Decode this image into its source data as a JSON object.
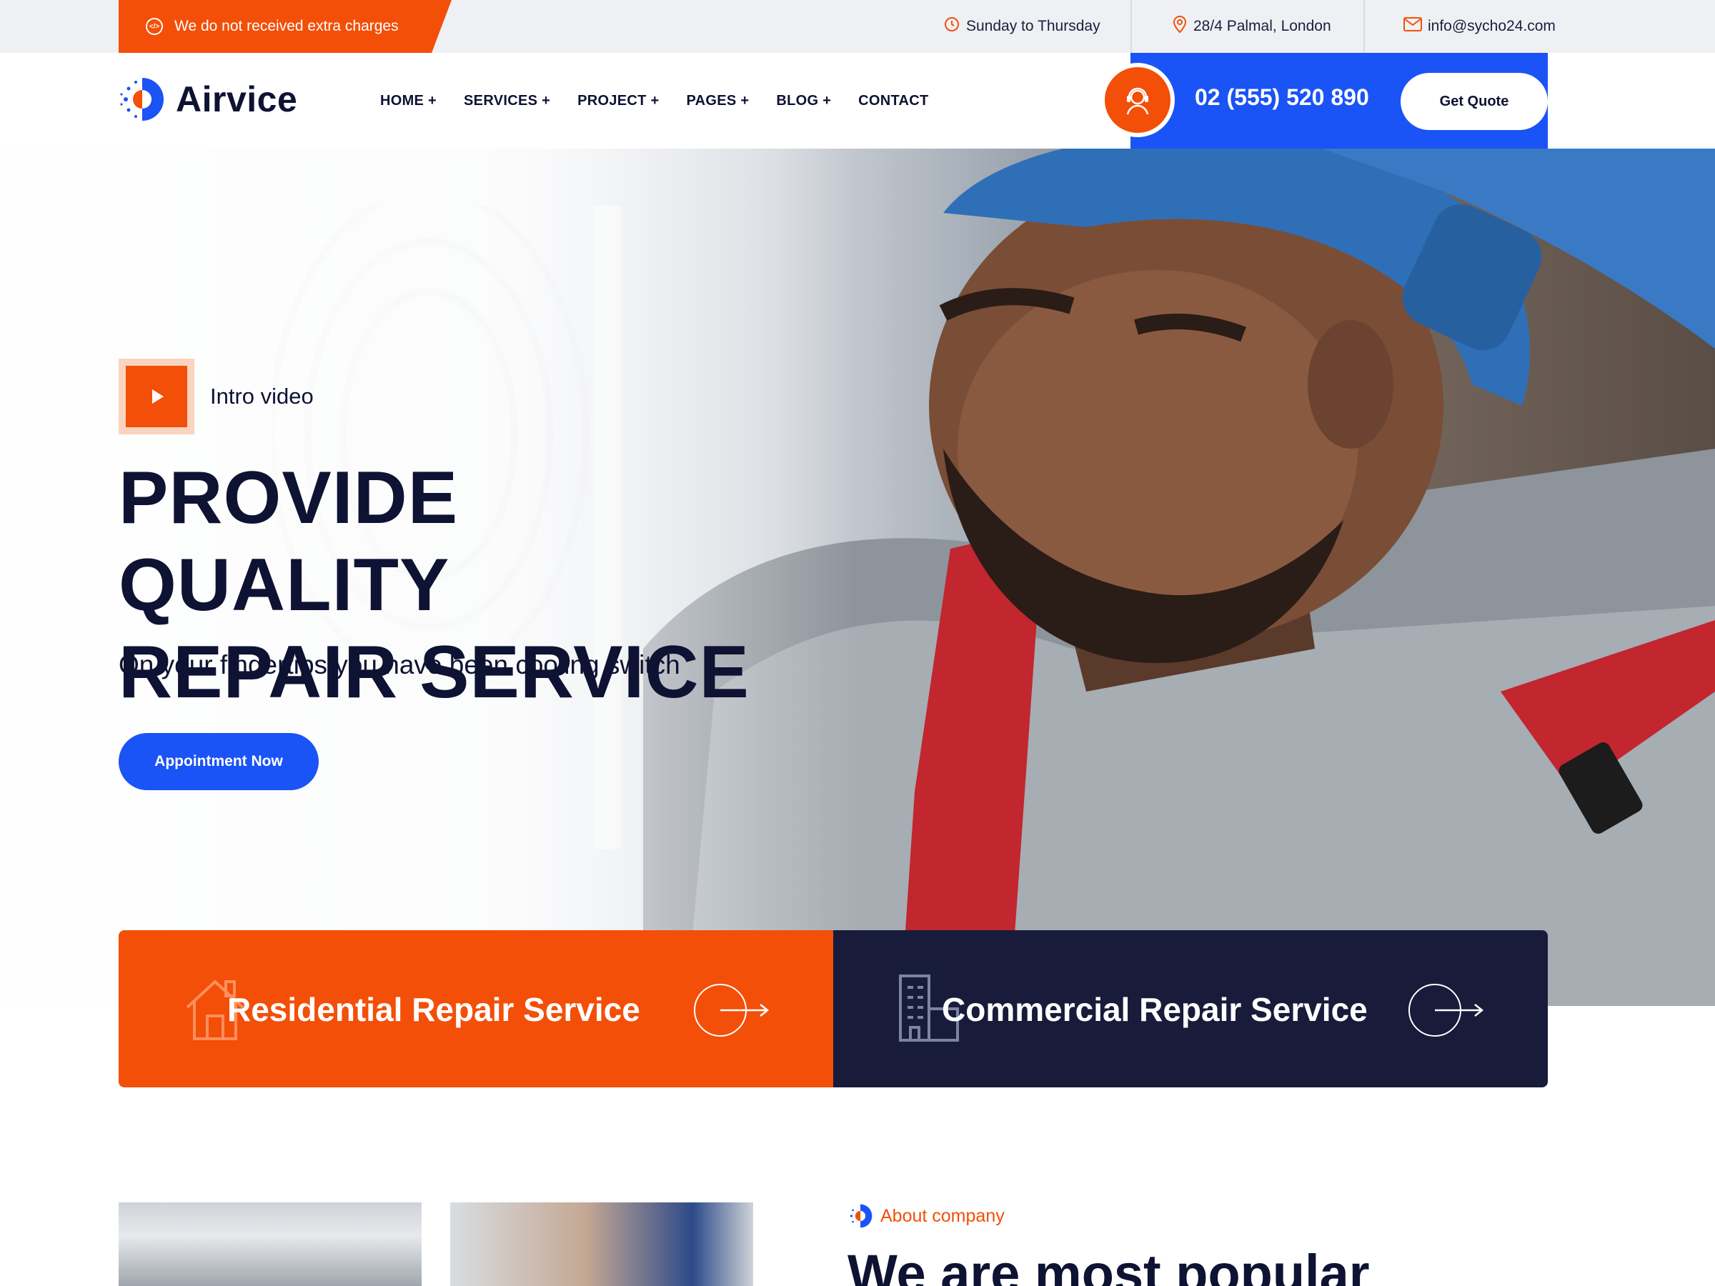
{
  "topbar": {
    "promo": "We do not received extra charges",
    "hours": "Sunday to Thursday",
    "address": "28/4 Palmal, London",
    "email": "info@sycho24.com"
  },
  "header": {
    "logo": "Airvice",
    "nav": [
      "HOME +",
      "SERVICES +",
      "PROJECT +",
      "PAGES +",
      "BLOG +",
      "CONTACT"
    ],
    "phone": "02 (555) 520 890",
    "quote_button": "Get Quote"
  },
  "hero": {
    "intro_label": "Intro video",
    "title_line1": "PROVIDE QUALITY",
    "title_line2": "REPAIR SERVICE",
    "subtitle": "On your fingertips you have been cooling switch",
    "cta": "Appointment Now"
  },
  "services": [
    {
      "title": "Residential Repair Service",
      "icon": "house-icon"
    },
    {
      "title": "Commercial Repair Service",
      "icon": "building-icon"
    }
  ],
  "about": {
    "kicker": "About company",
    "title": "We are most popular"
  },
  "colors": {
    "accent_orange": "#f34f08",
    "accent_blue": "#1a53f6",
    "navy": "#181c3a"
  }
}
